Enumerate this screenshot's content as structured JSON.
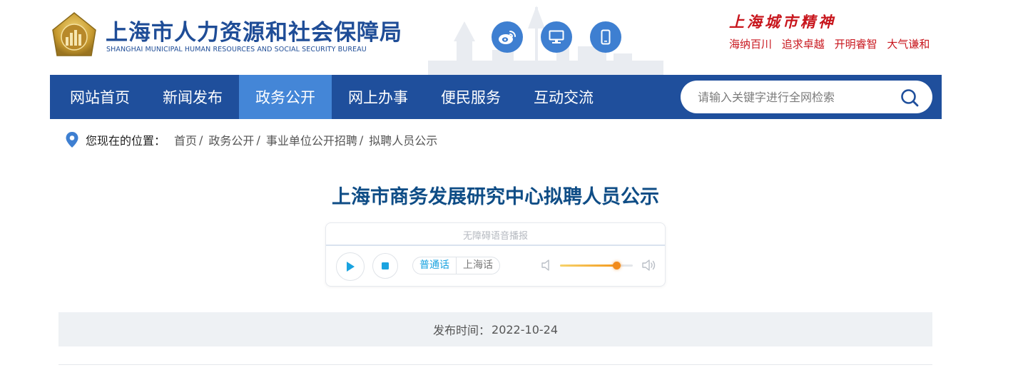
{
  "header": {
    "site_title": "上海市人力资源和社会保障局",
    "site_subtitle": "SHANGHAI MUNICIPAL HUMAN RESOURCES AND SOCIAL SECURITY BUREAU",
    "icons": [
      "weibo-icon",
      "desktop-icon",
      "mobile-icon"
    ],
    "spirit_title": "上海城市精神",
    "spirit_words": [
      "海纳百川",
      "追求卓越",
      "开明睿智",
      "大气谦和"
    ],
    "colors": {
      "brand": "#1f4d97",
      "icon_bg": "#3e7fd1",
      "spirit": "#c8161d"
    }
  },
  "nav": {
    "items": [
      {
        "label": "网站首页"
      },
      {
        "label": "新闻发布"
      },
      {
        "label": "政务公开",
        "active": true
      },
      {
        "label": "网上办事"
      },
      {
        "label": "便民服务"
      },
      {
        "label": "互动交流"
      }
    ],
    "search_placeholder": "请输入关键字进行全网检索",
    "colors": {
      "bar": "#1f4f9c",
      "active": "#4486d7"
    }
  },
  "breadcrumb": {
    "label": "您现在的位置：",
    "items": [
      "首页",
      "政务公开",
      "事业单位公开招聘",
      "拟聘人员公示"
    ],
    "separator": "/"
  },
  "article": {
    "title": "上海市商务发展研究中心拟聘人员公示",
    "publish_label": "发布时间：",
    "publish_date": "2022-10-24"
  },
  "player": {
    "caption": "无障碍语音播报",
    "dialects": [
      "普通话",
      "上海话"
    ],
    "volume_fraction": 0.77
  }
}
